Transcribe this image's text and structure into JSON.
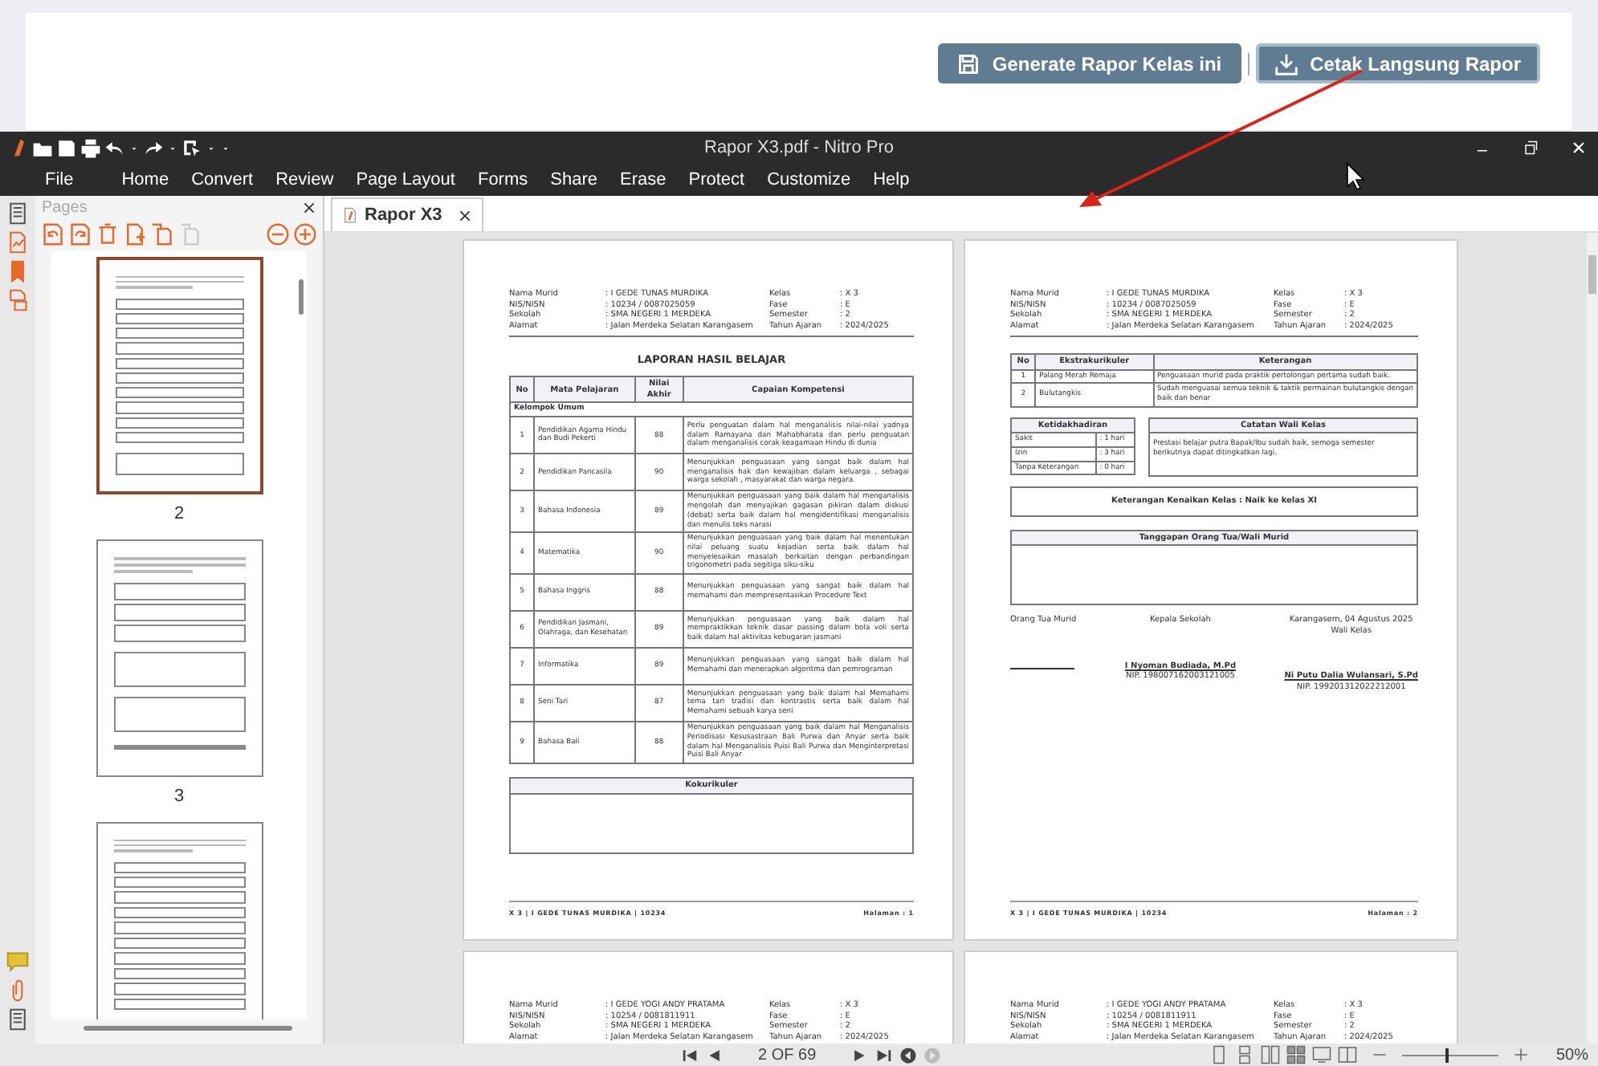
{
  "web": {
    "buttons": [
      {
        "label": "Generate Rapor Kelas ini",
        "focused": false
      },
      {
        "label": "Cetak Langsung Rapor",
        "focused": true
      }
    ]
  },
  "window": {
    "title": "Rapor X3.pdf - Nitro Pro"
  },
  "menu": [
    {
      "label": "File"
    },
    {
      "label": "Home"
    },
    {
      "label": "Convert"
    },
    {
      "label": "Review"
    },
    {
      "label": "Page Layout"
    },
    {
      "label": "Forms"
    },
    {
      "label": "Share"
    },
    {
      "label": "Erase"
    },
    {
      "label": "Protect"
    },
    {
      "label": "Customize"
    },
    {
      "label": "Help"
    }
  ],
  "pages_panel": {
    "title": "Pages",
    "thumbnails": [
      {
        "label": "2",
        "kind": "grades",
        "selected": true
      },
      {
        "label": "3",
        "kind": "attendance",
        "selected": false
      },
      {
        "kind": "grades",
        "selected": false
      }
    ]
  },
  "tab": {
    "label": "Rapor X3"
  },
  "documents": [
    {
      "kind": "grades",
      "info_left": [
        {
          "label": "Nama Murid",
          "value": ": I GEDE TUNAS MURDIKA"
        },
        {
          "label": "NIS/NISN",
          "value": ": 10234 / 0087025059"
        },
        {
          "label": "Sekolah",
          "value": ": SMA NEGERI 1 MERDEKA"
        },
        {
          "label": "Alamat",
          "value": ": Jalan Merdeka Selatan Karangasem"
        }
      ],
      "info_right": [
        {
          "label": "Kelas",
          "value": ": X 3"
        },
        {
          "label": "Fase",
          "value": ": E"
        },
        {
          "label": "Semester",
          "value": ": 2"
        },
        {
          "label": "Tahun Ajaran",
          "value": ": 2024/2025"
        }
      ],
      "title": "LAPORAN HASIL BELAJAR",
      "columns": [
        "No",
        "Mata Pelajaran",
        "Nilai Akhir",
        "Capaian Kompetensi"
      ],
      "group": "Kelompok Umum",
      "rows": [
        {
          "no": "1",
          "subject": "Pendidikan Agama Hindu dan Budi Pekerti",
          "score": "88",
          "description": "Perlu penguatan dalam hal menganalisis nilai-nilai yadnya dalam Ramayana dan Mahabharata dan perlu penguatan dalam menganalisis corak keagamaan Hindu di dunia"
        },
        {
          "no": "2",
          "subject": "Pendidikan Pancasila",
          "score": "90",
          "description": "Menunjukkan penguasaan yang sangat baik dalam hal menganalisis hak dan kewajiban dalam keluarga , sebagai warga sekolah , masyarakat dan warga negara."
        },
        {
          "no": "3",
          "subject": "Bahasa Indonesia",
          "score": "89",
          "description": "Menunjukkan penguasaan yang baik dalam hal menganalisis mengolah dan menyajikan gagasan pikiran dalam diskusi (debat) serta baik dalam hal mengidentifikasi menganalisis dan menulis teks narasi"
        },
        {
          "no": "4",
          "subject": "Matematika",
          "score": "90",
          "description": "Menunjukkan penguasaan yang baik dalam hal menentukan nilai peluang suatu kejadian serta baik dalam hal menyelesaikan masalah berkaitan dengan perbandingan trigonometri pada segitiga siku-siku"
        },
        {
          "no": "5",
          "subject": "Bahasa Inggris",
          "score": "88",
          "description": "Menunjukkan penguasaan yang sangat baik dalam hal memahami dan mempresentasikan Procedure Text"
        },
        {
          "no": "6",
          "subject": "Pendidikan Jasmani, Olahraga, dan Kesehatan",
          "score": "89",
          "description": "Menunjukkan penguasaan yang baik dalam hal mempraktikkan teknik dasar passing dalam bola voli serta baik dalam hal aktivitas kebugaran jasmani"
        },
        {
          "no": "7",
          "subject": "Informatika",
          "score": "89",
          "description": "Menunjukkan penguasaan yang sangat baik dalam hal Memahami dan menerapkan algoritma dan pemrograman"
        },
        {
          "no": "8",
          "subject": "Seni Tari",
          "score": "87",
          "description": "Menunjukkan penguasaan yang baik dalam hal Memahami tema tari tradisi dan kontrastis serta baik dalam hal Memahami sebuah karya seni"
        },
        {
          "no": "9",
          "subject": "Bahasa Bali",
          "score": "88",
          "description": "Menunjukkan penguasaan yang baik dalam hal Menganalisis Periodisasi Kesusastraan Bali Purwa dan Anyar serta baik dalam hal Menganalisis Puisi Bali Purwa dan Menginterpretasi Puisi Bali Anyar"
        }
      ],
      "kokurikuler": "Kokurikuler",
      "footer_left": "X 3 | I GEDE TUNAS MURDIKA | 10234",
      "footer_right": "Halaman : 1"
    },
    {
      "kind": "attendance",
      "info_left": [
        {
          "label": "Nama Murid",
          "value": ": I GEDE TUNAS MURDIKA"
        },
        {
          "label": "NIS/NISN",
          "value": ": 10234 / 0087025059"
        },
        {
          "label": "Sekolah",
          "value": ": SMA NEGERI 1 MERDEKA"
        },
        {
          "label": "Alamat",
          "value": ": Jalan Merdeka Selatan Karangasem"
        }
      ],
      "info_right": [
        {
          "label": "Kelas",
          "value": ": X 3"
        },
        {
          "label": "Fase",
          "value": ": E"
        },
        {
          "label": "Semester",
          "value": ": 2"
        },
        {
          "label": "Tahun Ajaran",
          "value": ": 2024/2025"
        }
      ],
      "extra_columns": [
        "No",
        "Ekstrakurikuler",
        "Keterangan"
      ],
      "extra_rows": [
        {
          "no": "1",
          "name": "Palang Merah Remaja",
          "note": "Penguasaan murid pada praktik pertolongan pertama sudah baik."
        },
        {
          "no": "2",
          "name": "Bulutangkis",
          "note": "Sudah menguasai semua teknik & taktik permainan bulutangkis dengan baik dan benar"
        }
      ],
      "absence_title": "Ketidakhadiran",
      "absence": [
        {
          "label": "Sakit",
          "value": ": 1 hari"
        },
        {
          "label": "Izin",
          "value": ": 3 hari"
        },
        {
          "label": "Tanpa Keterangan",
          "value": ": 0 hari"
        }
      ],
      "notes_title": "Catatan Wali Kelas",
      "notes": "Prestasi belajar putra Bapak/Ibu sudah baik, semoga semester berikutnya dapat ditingkatkan lagi.",
      "promotion": "Keterangan Kenaikan Kelas :  Naik ke kelas XI",
      "response_title": "Tanggapan Orang Tua/Wali Murid",
      "signatures": [
        {
          "role": "Orang Tua Murid"
        },
        {
          "role": "Kepala Sekolah",
          "name": "I Nyoman Budiada, M.Pd",
          "nip": "NIP. 198007162003121005"
        },
        {
          "place_date": "Karangasem, 04 Agustus 2025",
          "role": "Wali Kelas",
          "name": "Ni Putu Dalia Wulansari, S.Pd",
          "nip": "NIP. 199201312022212001"
        }
      ],
      "footer_left": "X 3 | I GEDE TUNAS MURDIKA | 10234",
      "footer_right": "Halaman : 2"
    },
    {
      "kind": "header_only",
      "info_left": [
        {
          "label": "Nama Murid",
          "value": ": I GEDE YOGI ANDY PRATAMA"
        },
        {
          "label": "NIS/NISN",
          "value": ": 10254 / 0081811911"
        },
        {
          "label": "Sekolah",
          "value": ": SMA NEGERI 1 MERDEKA"
        },
        {
          "label": "Alamat",
          "value": ": Jalan Merdeka Selatan Karangasem"
        }
      ],
      "info_right": [
        {
          "label": "Kelas",
          "value": ": X 3"
        },
        {
          "label": "Fase",
          "value": ": E"
        },
        {
          "label": "Semester",
          "value": ": 2"
        },
        {
          "label": "Tahun Ajaran",
          "value": ": 2024/2025"
        }
      ]
    },
    {
      "kind": "header_only",
      "info_left": [
        {
          "label": "Nama Murid",
          "value": ": I GEDE YOGI ANDY PRATAMA"
        },
        {
          "label": "NIS/NISN",
          "value": ": 10254 / 0081811911"
        },
        {
          "label": "Sekolah",
          "value": ": SMA NEGERI 1 MERDEKA"
        },
        {
          "label": "Alamat",
          "value": ": Jalan Merdeka Selatan Karangasem"
        }
      ],
      "info_right": [
        {
          "label": "Kelas",
          "value": ": X 3"
        },
        {
          "label": "Fase",
          "value": ": E"
        },
        {
          "label": "Semester",
          "value": ": 2"
        },
        {
          "label": "Tahun Ajaran",
          "value": ": 2024/2025"
        }
      ]
    }
  ],
  "status_bar": {
    "page_indicator": "2 OF 69",
    "level": 0.45,
    "zoom": "50%"
  }
}
